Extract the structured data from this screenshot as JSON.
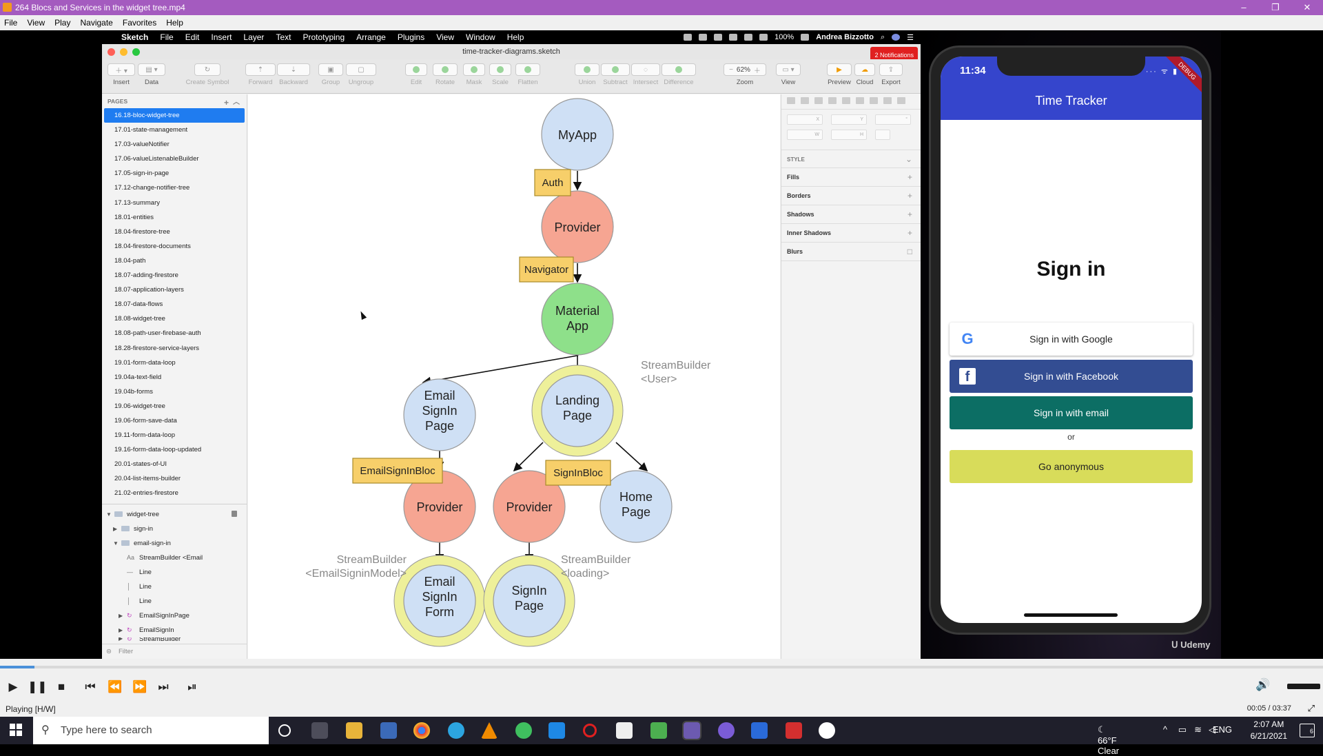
{
  "vlc": {
    "title": "264 Blocs and Services in the widget tree.mp4",
    "menu": [
      "File",
      "View",
      "Play",
      "Navigate",
      "Favorites",
      "Help"
    ],
    "win_controls": [
      "–",
      "❐",
      "✕"
    ]
  },
  "mac_menubar": {
    "items": [
      "Sketch",
      "File",
      "Edit",
      "Insert",
      "Layer",
      "Text",
      "Prototyping",
      "Arrange",
      "Plugins",
      "View",
      "Window",
      "Help"
    ],
    "battery": "100%",
    "user": "Andrea Bizzotto"
  },
  "sketch": {
    "file_title": "time-tracker-diagrams.sketch",
    "notifications": "2 Notifications",
    "toolbar": {
      "insert": "Insert",
      "data": "Data",
      "create_symbol": "Create Symbol",
      "forward": "Forward",
      "backward": "Backward",
      "group": "Group",
      "ungroup": "Ungroup",
      "edit": "Edit",
      "rotate": "Rotate",
      "mask": "Mask",
      "scale": "Scale",
      "flatten": "Flatten",
      "union": "Union",
      "subtract": "Subtract",
      "intersect": "Intersect",
      "difference": "Difference",
      "zoom": "Zoom",
      "zoom_value": "62%",
      "view": "View",
      "preview": "Preview",
      "cloud": "Cloud",
      "export": "Export"
    },
    "pages_header": "PAGES",
    "pages": [
      "16.18-bloc-widget-tree",
      "17.01-state-management",
      "17.03-valueNotifier",
      "17.06-valueListenableBuilder",
      "17.05-sign-in-page",
      "17.12-change-notifier-tree",
      "17.13-summary",
      "18.01-entities",
      "18.04-firestore-tree",
      "18.04-firestore-documents",
      "18.04-path",
      "18.07-adding-firestore",
      "18.07-application-layers",
      "18.07-data-flows",
      "18.08-widget-tree",
      "18.08-path-user-firebase-auth",
      "18.28-firestore-service-layers",
      "19.01-form-data-loop",
      "19.04a-text-field",
      "19.04b-forms",
      "19.06-widget-tree",
      "19.06-form-save-data",
      "19.11-form-data-loop",
      "19.16-form-data-loop-updated",
      "20.01-states-of-UI",
      "20.04-list-items-builder",
      "21.02-entries-firestore"
    ],
    "layers": {
      "artboard": "widget-tree",
      "g1": "sign-in",
      "g2": "email-sign-in",
      "text_layer": "StreamBuilder <Email",
      "line": "Line",
      "sym1": "EmailSignInPage",
      "sym2": "EmailSignIn",
      "sym3": "StreamBuilder"
    },
    "filter": "Filter",
    "inspector": {
      "x": "X",
      "y": "Y",
      "w": "W",
      "h": "H",
      "style": "STYLE",
      "fills": "Fills",
      "borders": "Borders",
      "shadows": "Shadows",
      "inner_shadows": "Inner Shadows",
      "blurs": "Blurs"
    },
    "diagram": {
      "nodes": {
        "myapp": "MyApp",
        "provider_top": "Provider",
        "material_1": "Material",
        "material_2": "App",
        "email_signin_page": [
          "Email",
          "SignIn",
          "Page"
        ],
        "landing_page": [
          "Landing",
          "Page"
        ],
        "provider_left": "Provider",
        "provider_mid": "Provider",
        "home_page": [
          "Home",
          "Page"
        ],
        "email_signin_form": [
          "Email",
          "SignIn",
          "Form"
        ],
        "signin_page": [
          "SignIn",
          "Page"
        ]
      },
      "tags": {
        "auth": "Auth",
        "navigator": "Navigator",
        "email_signin_bloc": "EmailSignInBloc",
        "signin_bloc": "SignInBloc"
      },
      "labels": {
        "sb_user_1": "StreamBuilder",
        "sb_user_2": "<User>",
        "sb_email_1": "StreamBuilder",
        "sb_email_2": "<EmailSigninModel>",
        "sb_loading_1": "StreamBuilder",
        "sb_loading_2": "<loading>"
      },
      "colors": {
        "blue": "#cfe0f5",
        "salmon": "#f6a592",
        "green": "#8ee08a",
        "tag": "#f7cf6a",
        "ring": "#eef09a"
      }
    }
  },
  "phone": {
    "time": "11:34",
    "status": "··· ᯤ ▮",
    "debug": "DEBUG",
    "app_title": "Time Tracker",
    "heading": "Sign in",
    "google": "Sign in with Google",
    "google_icon": "G",
    "facebook": "Sign in with Facebook",
    "facebook_icon": "f",
    "email": "Sign in with email",
    "or": "or",
    "anonymous": "Go anonymous"
  },
  "watermark": "Udemy",
  "player": {
    "status": "Playing [H/W]",
    "time": "00:05 / 03:37"
  },
  "taskbar": {
    "search_placeholder": "Type here to search",
    "weather": "66°F  Clear",
    "lang": "ENG",
    "time": "2:07 AM",
    "date": "6/21/2021",
    "notifications": "6"
  }
}
